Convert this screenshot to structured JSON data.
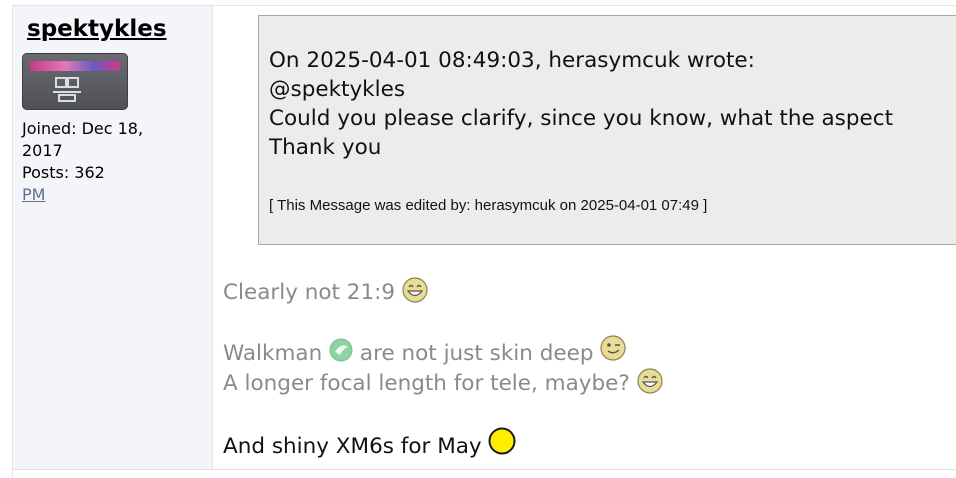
{
  "author": {
    "username": "spektykles",
    "joined_line1": "Joined: Dec 18,",
    "joined_line2": "2017",
    "posts": "Posts: 362",
    "pm_label": "PM"
  },
  "quote": {
    "header": "On 2025-04-01 08:49:03, herasymcuk wrote:",
    "line1": "@spektykles",
    "line2": "Could you please clarify, since you know, what the aspect",
    "line3": "Thank you",
    "edit_note": "[ This Message was edited by: herasymcuk on 2025-04-01 07:49 ]"
  },
  "post": {
    "line1_text": "Clearly not 21:9",
    "line2_a": "Walkman",
    "line2_b": "are not just skin deep",
    "line3_text": "A longer focal length for tele, maybe?",
    "line4_text": "And shiny XM6s for May"
  },
  "icons": {
    "avatar": "avatar-image",
    "laughing": "laughing-smiley-icon",
    "walkman": "walkman-logo-icon",
    "wink": "wink-smiley-icon",
    "plain": "yellow-circle-smiley-icon"
  },
  "colors": {
    "sidebar_bg": "#f3f5f9",
    "quote_bg": "#ececec",
    "post_gray_text": "#8a8a8a",
    "link": "#5a7090"
  }
}
